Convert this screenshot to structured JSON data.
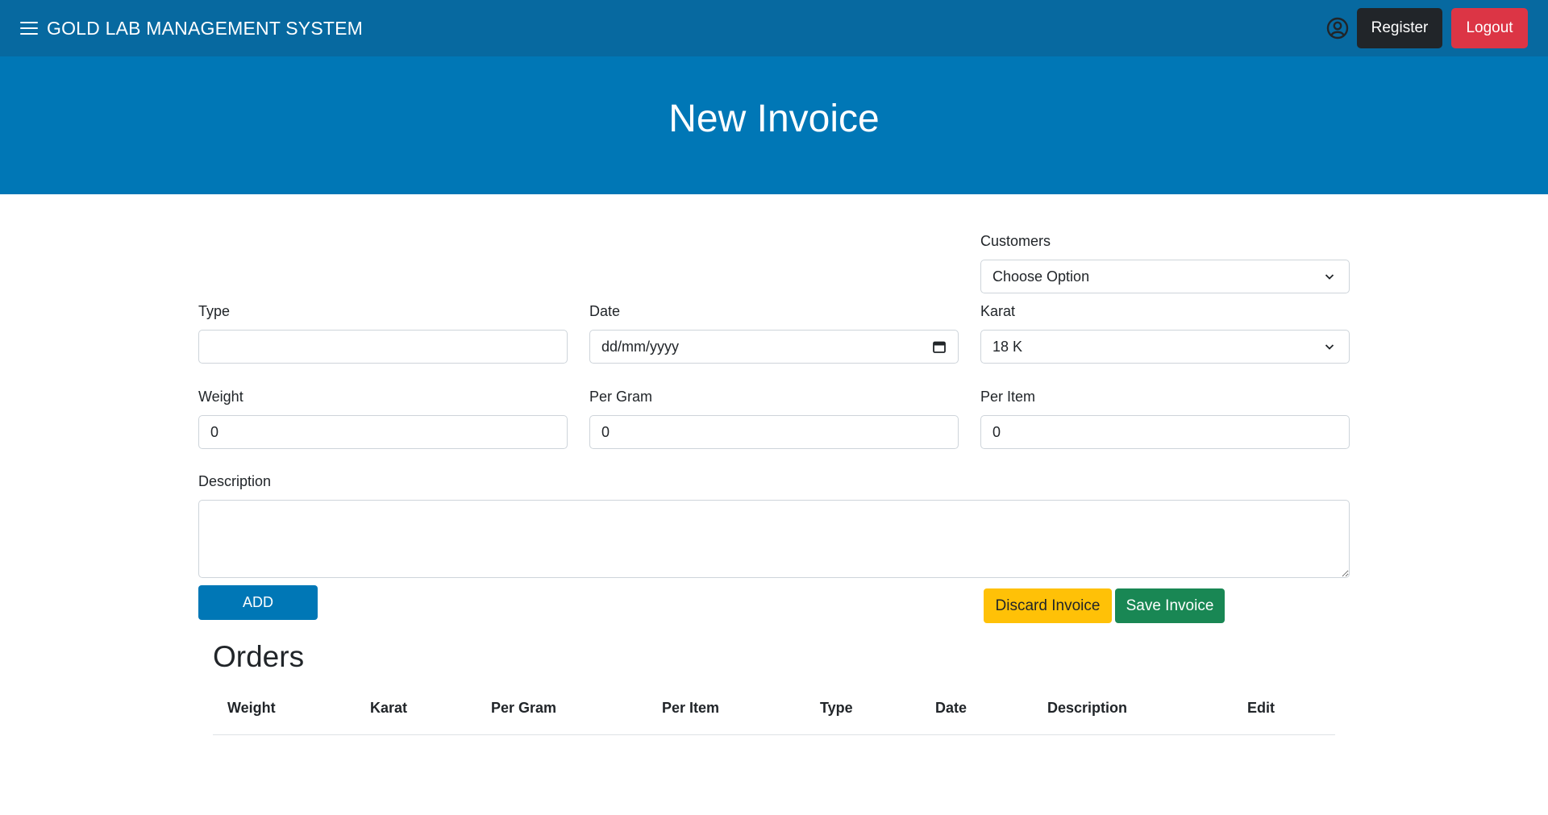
{
  "navbar": {
    "brand": "GOLD LAB MANAGEMENT SYSTEM",
    "register_label": "Register",
    "logout_label": "Logout",
    "icons": [
      "menu-icon",
      "user-circle-icon"
    ]
  },
  "hero": {
    "title": "New Invoice"
  },
  "form": {
    "customers": {
      "label": "Customers",
      "value": "Choose Option"
    },
    "type": {
      "label": "Type",
      "value": ""
    },
    "date": {
      "label": "Date",
      "placeholder": "dd/mm/yyyy"
    },
    "karat": {
      "label": "Karat",
      "value": "18 K"
    },
    "weight": {
      "label": "Weight",
      "value": "0"
    },
    "per_gram": {
      "label": "Per Gram",
      "value": "0"
    },
    "per_item": {
      "label": "Per Item",
      "value": "0"
    },
    "description": {
      "label": "Description",
      "value": ""
    },
    "add_label": "ADD",
    "discard_label": "Discard Invoice",
    "save_label": "Save Invoice"
  },
  "orders": {
    "title": "Orders",
    "columns": [
      "Weight",
      "Karat",
      "Per Gram",
      "Per Item",
      "Type",
      "Date",
      "Description",
      "Edit"
    ],
    "rows": []
  },
  "colors": {
    "navbar": "#0769a0",
    "hero": "#0077b6",
    "register": "#212529",
    "logout": "#dc3545",
    "discard": "#ffc107",
    "save": "#198754"
  }
}
